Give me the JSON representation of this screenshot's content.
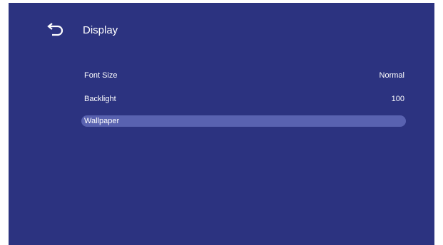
{
  "header": {
    "back_icon": "back-arrow-icon",
    "title": "Display"
  },
  "settings": {
    "items": [
      {
        "label": "Font Size",
        "value": "Normal"
      },
      {
        "label": "Backlight",
        "value": "100"
      },
      {
        "label": "Wallpaper",
        "value": "",
        "selected": true
      }
    ]
  },
  "colors": {
    "background": "#2c3380",
    "selected_row": "#5962b0",
    "text": "#ffffff"
  }
}
